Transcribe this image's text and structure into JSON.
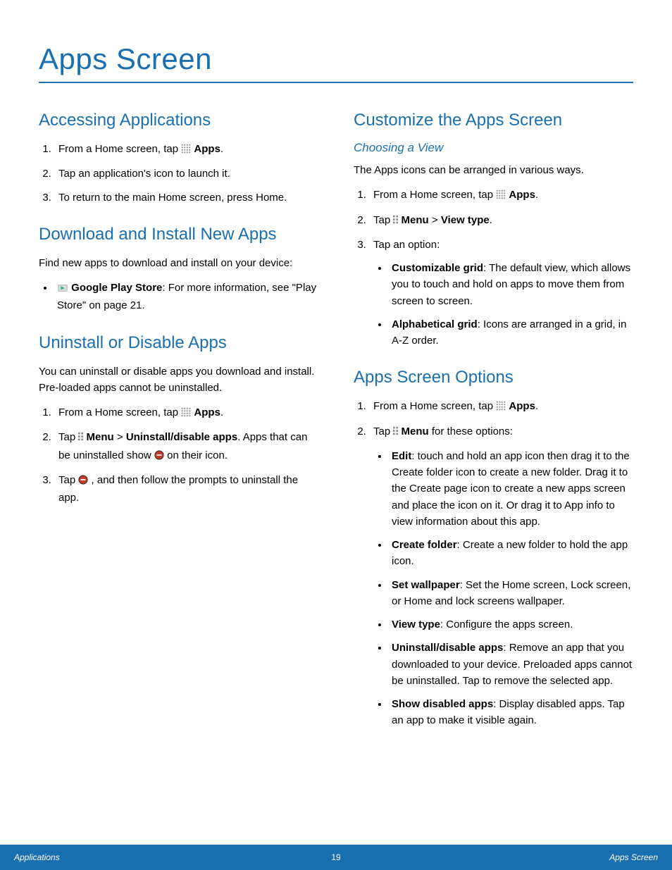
{
  "title": "Apps Screen",
  "left": {
    "s1": {
      "heading": "Accessing Applications",
      "steps": [
        {
          "pre": "From a Home screen, tap ",
          "icon": "apps-icon",
          "bold": "Apps",
          "post": "."
        },
        {
          "pre": "Tap an application's icon to launch it."
        },
        {
          "pre": "To return to the main Home screen, press  Home."
        }
      ]
    },
    "s2": {
      "heading": "Download and Install New Apps",
      "intro": "Find new apps to download and install on your device:",
      "bullets": [
        {
          "icon": "play-store-icon",
          "bold": "Google Play Store",
          "post": ": For more information, see \"Play Store\" on page 21."
        }
      ]
    },
    "s3": {
      "heading": "Uninstall or Disable Apps",
      "intro": "You can uninstall or disable apps you download and install. Pre-loaded apps cannot be uninstalled.",
      "steps": [
        {
          "pre": "From a Home screen, tap ",
          "icon": "apps-icon",
          "bold": "Apps",
          "post": "."
        },
        {
          "pre": "Tap ",
          "icon": "menu-icon",
          "bold": "Menu",
          "mid": " > ",
          "bold2": "Uninstall/disable apps",
          "post": ". Apps that can be uninstalled show ",
          "icon2": "minus-icon",
          "post2": " on their icon."
        },
        {
          "pre": "Tap ",
          "icon": "minus-icon",
          "post": ", and then follow the prompts to uninstall the app."
        }
      ]
    }
  },
  "right": {
    "s1": {
      "heading": "Customize the Apps Screen",
      "sub": "Choosing a View",
      "intro": "The Apps icons can be arranged in various ways.",
      "steps": [
        {
          "pre": "From a Home screen, tap ",
          "icon": "apps-icon",
          "bold": "Apps",
          "post": "."
        },
        {
          "pre": "Tap ",
          "icon": "menu-icon",
          "bold": "Menu",
          "mid": " > ",
          "bold2": "View type",
          "post": "."
        },
        {
          "pre": "Tap an option:",
          "subbullets": [
            {
              "bold": "Customizable grid",
              "post": ": The default view, which allows you to touch and hold on apps to move them from screen to screen."
            },
            {
              "bold": "Alphabetical grid",
              "post": ": Icons are arranged in a grid, in A-Z order."
            }
          ]
        }
      ]
    },
    "s2": {
      "heading": "Apps Screen Options",
      "steps": [
        {
          "pre": "From a Home screen, tap ",
          "icon": "apps-icon",
          "bold": "Apps",
          "post": "."
        },
        {
          "pre": "Tap ",
          "icon": "menu-icon",
          "bold": "Menu",
          "post": " for these options:",
          "subbullets": [
            {
              "bold": "Edit",
              "post": ": touch and hold an app icon then drag it to the Create folder icon to create a new folder. Drag it to the Create page icon to create a new apps screen and place the icon on it. Or drag it to App info to view information about this app."
            },
            {
              "bold": "Create folder",
              "post": ": Create a new folder to hold the app icon."
            },
            {
              "bold": "Set wallpaper",
              "post": ": Set the Home screen, Lock screen, or Home and lock screens wallpaper."
            },
            {
              "bold": "View type",
              "post": ": Configure the apps screen."
            },
            {
              "bold": "Uninstall/disable apps",
              "post": ": Remove an app that you downloaded to your device. Preloaded apps cannot be uninstalled. Tap  to remove the selected app."
            },
            {
              "bold": "Show disabled apps",
              "post": ": Display disabled apps. Tap an app to make it visible again."
            }
          ]
        }
      ]
    }
  },
  "footer": {
    "left": "Applications",
    "center": "19",
    "right": "Apps Screen"
  }
}
